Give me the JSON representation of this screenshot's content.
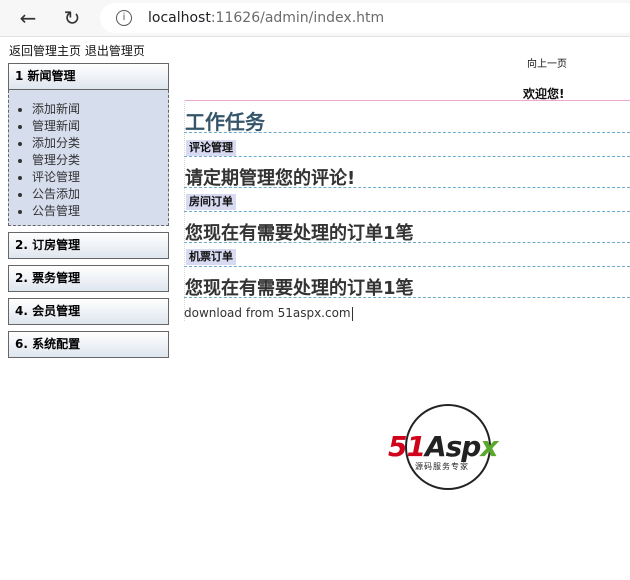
{
  "browser": {
    "url_host": "localhost",
    "url_rest": ":11626/admin/index.htm"
  },
  "toplinks": {
    "home": "返回管理主页",
    "logout": "退出管理页"
  },
  "sidebar": {
    "expanded": {
      "label": "1 新闻管理",
      "items": [
        "添加新闻",
        "管理新闻",
        "添加分类",
        "管理分类",
        "评论管理",
        "公告添加",
        "公告管理"
      ]
    },
    "groups": [
      {
        "label": "2. 订房管理"
      },
      {
        "label": "2. 票务管理"
      },
      {
        "label": "4. 会员管理"
      },
      {
        "label": "6. 系统配置"
      }
    ]
  },
  "main": {
    "prev_page": "向上一页",
    "welcome": "欢迎您!",
    "title": "工作任务",
    "sections": [
      {
        "tag": "评论管理",
        "message": "请定期管理您的评论!"
      },
      {
        "tag": "房间订单",
        "message": "您现在有需要处理的订单1笔"
      },
      {
        "tag": "机票订单",
        "message": "您现在有需要处理的订单1笔"
      }
    ],
    "footer_note": "download from 51aspx.com"
  },
  "logo": {
    "mark_red": "51",
    "mark_dark": "Asp",
    "mark_green": "x",
    "tagline": "源码服务专家"
  }
}
